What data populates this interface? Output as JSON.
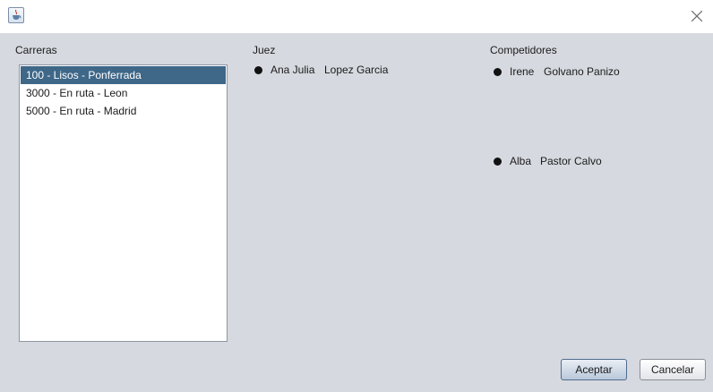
{
  "window": {
    "close_icon": "close-icon",
    "app_icon": "java-coffee-icon"
  },
  "carreras": {
    "label": "Carreras",
    "items": [
      {
        "label": "100 - Lisos - Ponferrada",
        "selected": true
      },
      {
        "label": "3000 - En ruta - Leon",
        "selected": false
      },
      {
        "label": "5000 - En ruta - Madrid",
        "selected": false
      }
    ]
  },
  "juez": {
    "label": "Juez",
    "person": {
      "first": "Ana Julia",
      "last": "Lopez Garcia"
    }
  },
  "competidores": {
    "label": "Competidores",
    "items": [
      {
        "first": "Irene",
        "last": "Golvano Panizo"
      },
      {
        "first": "Alba",
        "last": "Pastor Calvo"
      }
    ]
  },
  "buttons": {
    "accept_label": "Aceptar",
    "cancel_label": "Cancelar"
  },
  "colors": {
    "selection": "#3e6788",
    "background": "#d6d9df"
  }
}
